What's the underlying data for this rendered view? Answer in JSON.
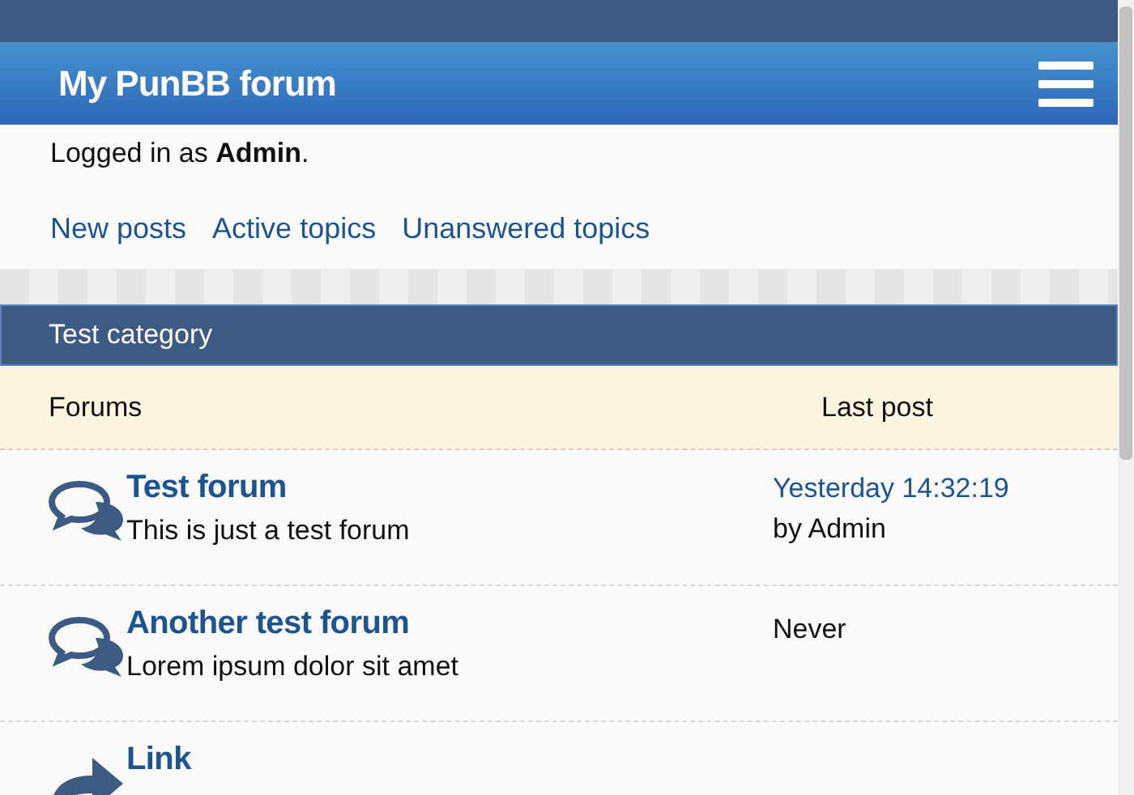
{
  "header": {
    "title": "My PunBB forum"
  },
  "user": {
    "prefix": "Logged in as ",
    "name": "Admin",
    "suffix": "."
  },
  "links": [
    "New posts",
    "Active topics",
    "Unanswered topics"
  ],
  "category": {
    "title": "Test category",
    "columns": [
      "Forums",
      "Last post"
    ],
    "forums": [
      {
        "kind": "forum",
        "name": "Test forum",
        "description": "This is just a test forum",
        "last_post": {
          "time": "Yesterday 14:32:19",
          "by": "by Admin"
        }
      },
      {
        "kind": "forum",
        "name": "Another test forum",
        "description": "Lorem ipsum dolor sit amet",
        "last_post_text": "Never"
      },
      {
        "kind": "redirect",
        "name": "Link"
      }
    ]
  }
}
